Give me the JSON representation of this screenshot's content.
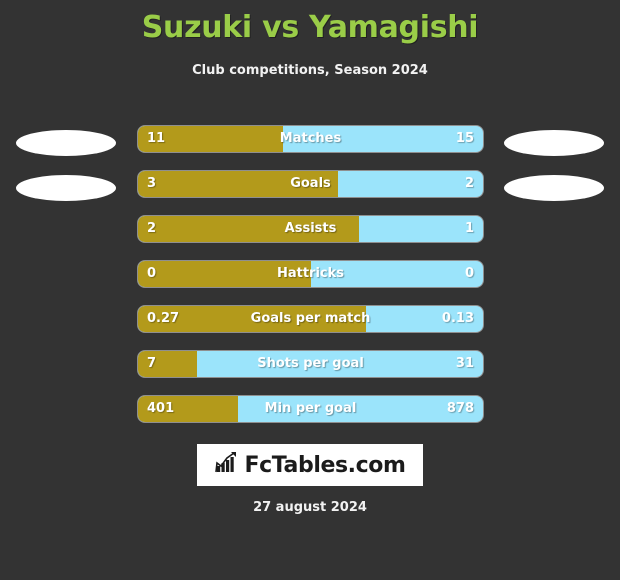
{
  "header": {
    "title": "Suzuki vs Yamagishi",
    "subtitle": "Club competitions, Season 2024"
  },
  "colors": {
    "background": "#333333",
    "title_green": "#9ACD48",
    "home_gold": "#B39A1B",
    "away_blue": "#9BE4FB",
    "text_white": "#FFFFFF",
    "logo_background": "#FFFFFF",
    "logo_text": "#1B1B1B"
  },
  "chart_data": {
    "type": "bar",
    "title": "Suzuki vs Yamagishi",
    "subtitle": "Club competitions, Season 2024",
    "orientation": "horizontal-diverging",
    "series": [
      {
        "name": "Suzuki",
        "color": "#B39A1B",
        "values": [
          "11",
          "3",
          "2",
          "0",
          "0.27",
          "7",
          "401"
        ]
      },
      {
        "name": "Yamagishi",
        "color": "#9BE4FB",
        "values": [
          "15",
          "2",
          "1",
          "0",
          "0.13",
          "31",
          "878"
        ]
      }
    ],
    "categories": [
      "Matches",
      "Goals",
      "Assists",
      "Hattricks",
      "Goals per match",
      "Shots per goal",
      "Min per goal"
    ],
    "rows": [
      {
        "label": "Matches",
        "home": "11",
        "away": "15",
        "home_pct": 42
      },
      {
        "label": "Goals",
        "home": "3",
        "away": "2",
        "home_pct": 58
      },
      {
        "label": "Assists",
        "home": "2",
        "away": "1",
        "home_pct": 64
      },
      {
        "label": "Hattricks",
        "home": "0",
        "away": "0",
        "home_pct": 50
      },
      {
        "label": "Goals per match",
        "home": "0.27",
        "away": "0.13",
        "home_pct": 66
      },
      {
        "label": "Shots per goal",
        "home": "7",
        "away": "31",
        "home_pct": 17
      },
      {
        "label": "Min per goal",
        "home": "401",
        "away": "878",
        "home_pct": 29
      }
    ],
    "grid": false,
    "legend": "none"
  },
  "logo": {
    "icon": "bar-chart-growth-icon",
    "text": "FcTables.com"
  },
  "footer": {
    "date": "27 august 2024"
  }
}
